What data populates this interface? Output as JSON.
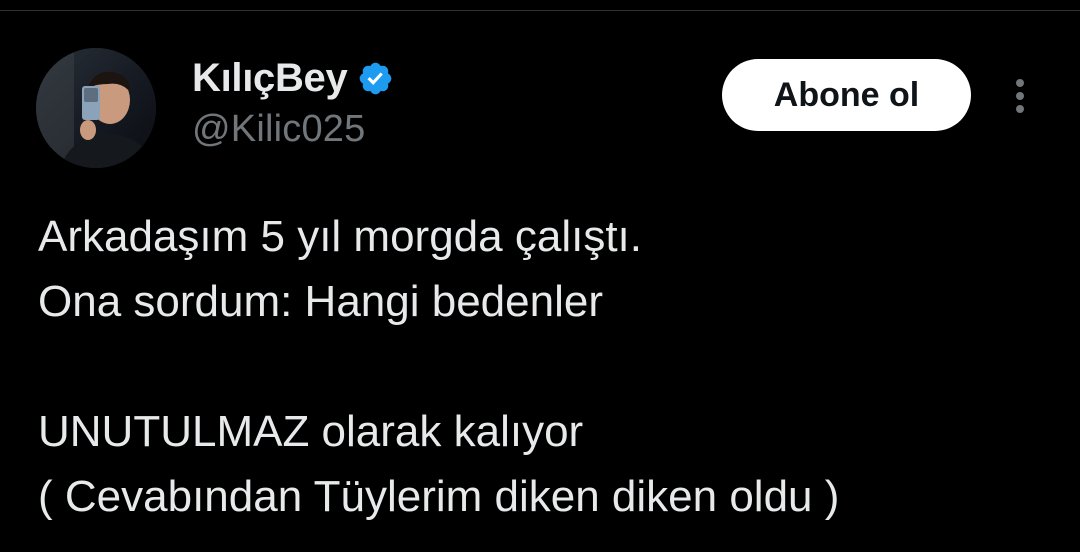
{
  "author": {
    "display_name": "KılıçBey",
    "handle": "@Kilic025",
    "verified": true,
    "verified_color": "#1d9bf0"
  },
  "actions": {
    "follow_label": "Abone ol",
    "more_icon": "more-vertical-icon"
  },
  "tweet": {
    "lines": [
      "Arkadaşım 5 yıl morgda çalıştı.",
      "Ona sordum: Hangi bedenler",
      "",
      "UNUTULMAZ olarak kalıyor",
      "( Cevabından Tüylerim diken diken oldu )"
    ]
  },
  "theme": {
    "background": "#000000",
    "text": "#e7e9ea",
    "secondary_text": "#71767b",
    "button_bg": "#ffffff",
    "button_text": "#0f1419"
  }
}
